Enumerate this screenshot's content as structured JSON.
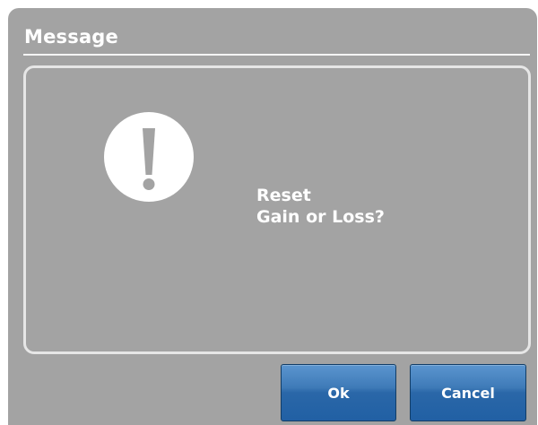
{
  "dialog": {
    "title": "Message",
    "message_lines": [
      "Reset",
      "Gain or Loss?"
    ],
    "icon": "exclamation-icon",
    "buttons": {
      "ok_label": "Ok",
      "cancel_label": "Cancel"
    }
  },
  "colors": {
    "dialog_background": "#a3a3a3",
    "button_blue": "#2a67a8",
    "text": "#ffffff"
  }
}
